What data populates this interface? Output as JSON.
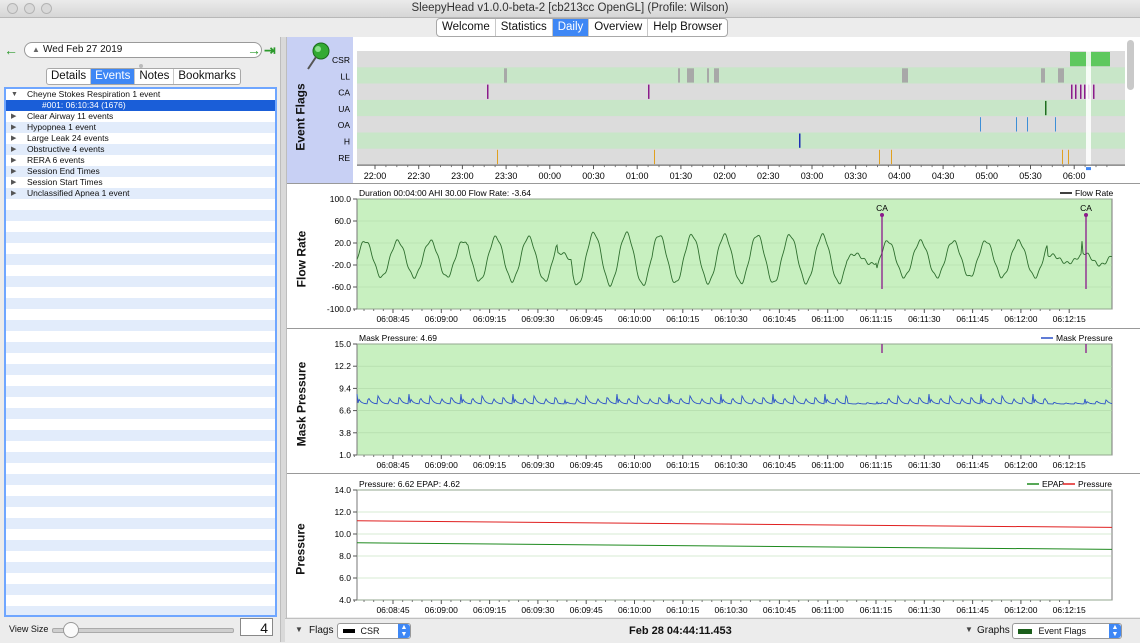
{
  "window": {
    "title": "SleepyHead v1.0.0-beta-2 [cb213cc OpenGL] (Profile: Wilson)"
  },
  "main_tabs": [
    "Welcome",
    "Statistics",
    "Daily",
    "Overview",
    "Help Browser"
  ],
  "active_main_tab": "Daily",
  "date_nav": {
    "back_icon": "back-arrow-icon",
    "forward_icon": "forward-arrow-icon",
    "last_icon": "jump-to-last-icon",
    "date": "Wed Feb 27 2019"
  },
  "sub_tabs": [
    "Details",
    "Events",
    "Notes",
    "Bookmarks"
  ],
  "active_sub_tab": "Events",
  "events": [
    {
      "label": "Cheyne Stokes Respiration 1 event",
      "expanded": true
    },
    {
      "label": "#001: 06:10:34 (1676)",
      "child": true,
      "selected": true
    },
    {
      "label": "Clear Airway 11 events"
    },
    {
      "label": "Hypopnea 1 event"
    },
    {
      "label": "Large Leak 24 events"
    },
    {
      "label": "Obstructive 4 events"
    },
    {
      "label": "RERA 6 events"
    },
    {
      "label": "Session End Times"
    },
    {
      "label": "Session Start Times"
    },
    {
      "label": "Unclassified Apnea 1 event"
    }
  ],
  "view_size": {
    "label": "View Size",
    "value": "4"
  },
  "event_flags": {
    "ylabel": "Event Flags",
    "rows": [
      "CSR",
      "LL",
      "CA",
      "UA",
      "OA",
      "H",
      "RE"
    ],
    "time_ticks": [
      "22:00",
      "22:30",
      "23:00",
      "23:30",
      "00:00",
      "00:30",
      "01:00",
      "01:30",
      "02:00",
      "02:30",
      "03:00",
      "03:30",
      "04:00",
      "04:30",
      "05:00",
      "05:30",
      "06:00"
    ],
    "colors": {
      "CSR": "#5ec85e",
      "LL": "#a8a8a8",
      "CA": "#8b1a8b",
      "UA": "#1e6e1e",
      "OA": "#3d8fd6",
      "H": "#1b2fb5",
      "RE": "#e0a020"
    }
  },
  "flow_rate": {
    "ylabel": "Flow Rate",
    "info": "Duration 00:04:00 AHI 30.00 Flow Rate: -3.64",
    "legend": "Flow Rate",
    "yticks": [
      "100.0",
      "60.0",
      "20.0",
      "-20.0",
      "-60.0",
      "-100.0"
    ],
    "annotations": [
      "CA",
      "CA"
    ]
  },
  "mask_pressure": {
    "ylabel": "Mask Pressure",
    "info": "Mask Pressure: 4.69",
    "legend": "Mask Pressure",
    "yticks": [
      "15.0",
      "12.2",
      "9.4",
      "6.6",
      "3.8",
      "1.0"
    ]
  },
  "pressure": {
    "ylabel": "Pressure",
    "info": "Pressure: 6.62 EPAP: 4.62",
    "legend_epap": "EPAP",
    "legend_pressure": "Pressure",
    "yticks": [
      "14.0",
      "12.0",
      "10.0",
      "8.0",
      "6.0",
      "4.0"
    ]
  },
  "time_axis": [
    "06:08:45",
    "06:09:00",
    "06:09:15",
    "06:09:30",
    "06:09:45",
    "06:10:00",
    "06:10:15",
    "06:10:30",
    "06:10:45",
    "06:11:00",
    "06:11:15",
    "06:11:30",
    "06:11:45",
    "06:12:00",
    "06:12:15"
  ],
  "bottom_bar": {
    "flags_label": "Flags",
    "flags_select": "CSR",
    "timestamp": "Feb 28 04:44:11.453",
    "graphs_label": "Graphs",
    "graphs_select": "Event Flags"
  },
  "colors": {
    "accent": "#3e87f5",
    "plot_bg": "#c8f0c0",
    "flow_line": "#2f6f2f",
    "mask_line": "#2b50c8",
    "epap_line": "#1f8a1f",
    "pressure_line": "#e02020"
  }
}
